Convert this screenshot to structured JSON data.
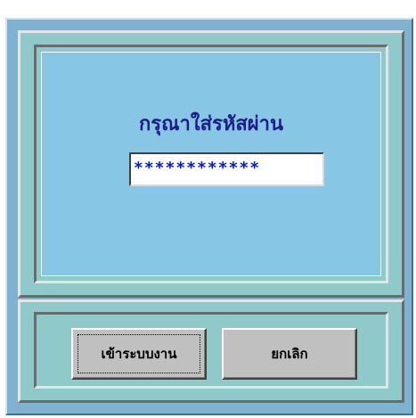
{
  "login_dialog": {
    "prompt": "กรุณาใส่รหัสผ่าน",
    "password_field": {
      "masked_value": "************"
    },
    "buttons": {
      "login_label": "เข้าระบบงาน",
      "cancel_label": "ยกเลิก"
    }
  },
  "colors": {
    "window_background": "#7fb2cf",
    "panel_background": "#8fc9c9",
    "prompt_area_background": "#88c6e6",
    "prompt_text": "#1d1d8a",
    "password_mask_text": "#0018d0",
    "button_face": "#c0c0c0"
  }
}
